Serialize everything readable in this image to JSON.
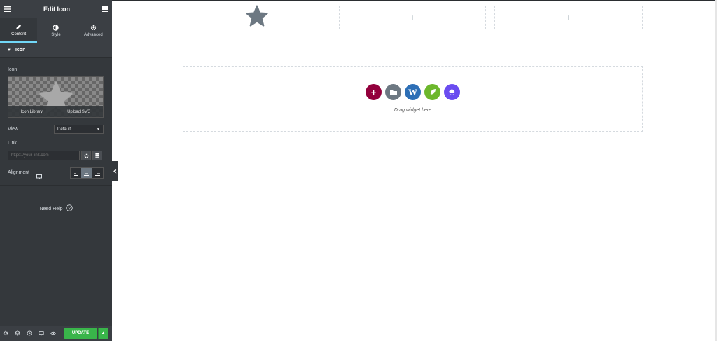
{
  "header": {
    "title": "Edit Icon",
    "menu_icon": "hamburger-icon",
    "grid_icon": "apps-grid-icon"
  },
  "tabs": [
    {
      "label": "Content",
      "icon": "pencil-icon",
      "active": true
    },
    {
      "label": "Style",
      "icon": "half-circle-icon",
      "active": false
    },
    {
      "label": "Advanced",
      "icon": "gear-icon",
      "active": false
    }
  ],
  "section": {
    "title": "Icon"
  },
  "icon_control": {
    "label": "Icon",
    "library_label": "Icon Library",
    "upload_label": "Upload SVG"
  },
  "view_control": {
    "label": "View",
    "value": "Default"
  },
  "link_control": {
    "label": "Link",
    "placeholder": "https://your-link.com"
  },
  "alignment_control": {
    "label": "Alignment",
    "selected": "center"
  },
  "help": {
    "label": "Need Help"
  },
  "footer": {
    "update_label": "UPDATE"
  },
  "colors": {
    "accent": "#71d7f7",
    "update": "#39b54a",
    "add": "#93003c",
    "folder": "#6d7882",
    "wp": "#2d6fb6",
    "leaf": "#6cb72c",
    "cloud": "#6a4cf0"
  },
  "canvas": {
    "drag_text": "Drag widget here"
  }
}
